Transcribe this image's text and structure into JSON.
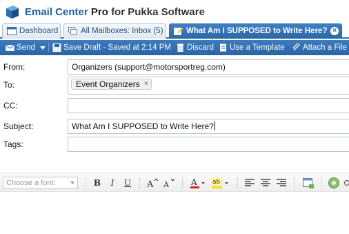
{
  "app": {
    "name": "Email Center",
    "pro": "Pro",
    "suffix": "for Pukka Software"
  },
  "tabs": [
    {
      "label": "Dashboard",
      "icon": "dashboard-icon"
    },
    {
      "label": "All Mailboxes: Inbox (5)",
      "icon": "mailboxes-icon"
    },
    {
      "label": "What Am I SUPPOSED to Write Here?",
      "icon": "compose-icon",
      "active": true
    }
  ],
  "toolbar": {
    "send": "Send",
    "save_draft": "Save Draft - Saved at 2:14 PM",
    "discard": "Discard",
    "use_template": "Use a Template",
    "attach_file": "Attach a File"
  },
  "form": {
    "from_label": "From:",
    "from_value": "Organizers (support@motorsportreg.com)",
    "to_label": "To:",
    "to_token": "Event Organizers",
    "cc_label": "CC:",
    "subject_label": "Subject:",
    "subject_value": "What Am I SUPPOSED to Write Here?",
    "tags_label": "Tags:"
  },
  "editor": {
    "font_placeholder": "Choose a font:",
    "bold": "B",
    "italic": "I",
    "underline": "U"
  },
  "colors": {
    "accent": "#2d6cb0",
    "title": "#1f5f9c"
  }
}
